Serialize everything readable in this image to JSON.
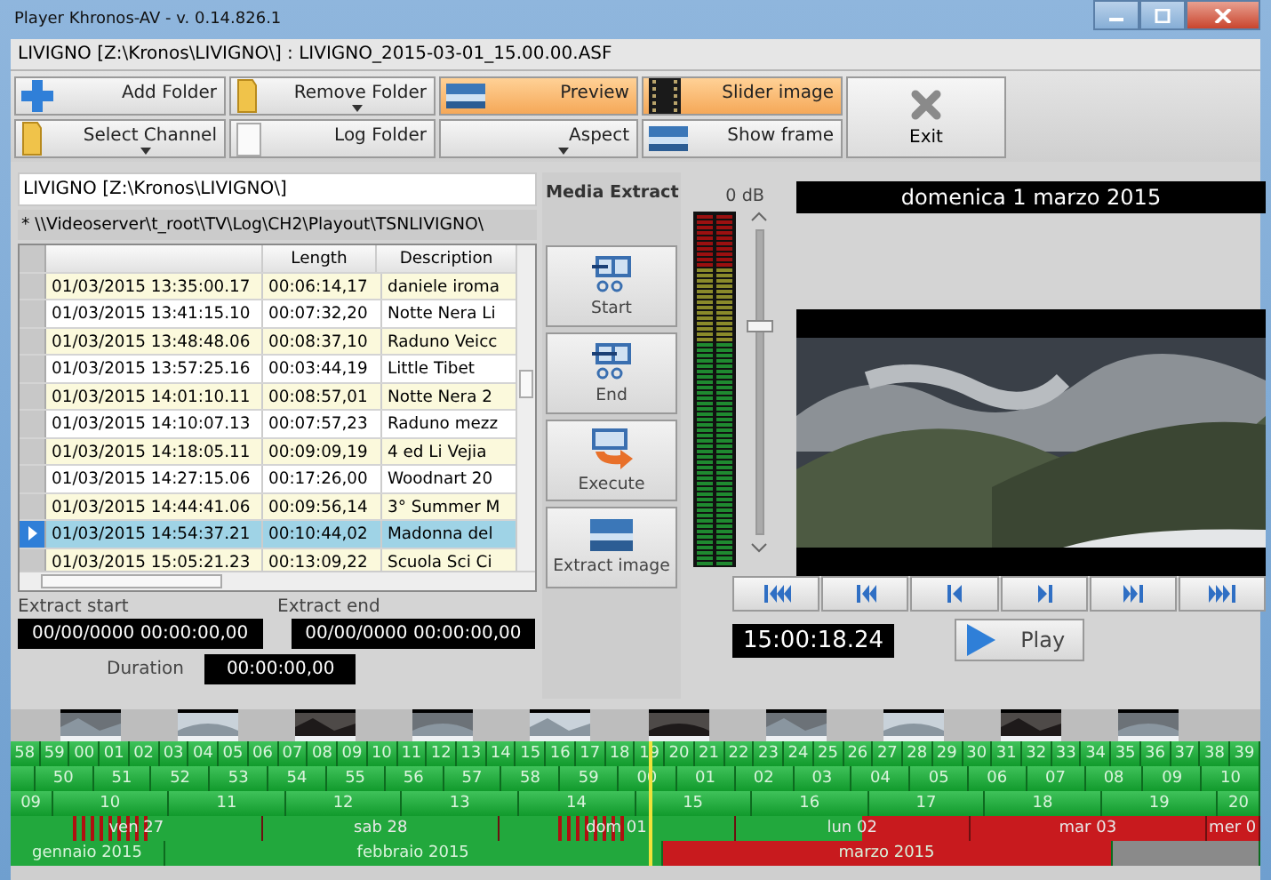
{
  "window": {
    "title": "Player Khronos-AV - v. 0.14.826.1"
  },
  "path_bar": "LIVIGNO [Z:\\Kronos\\LIVIGNO\\] : LIVIGNO_2015-03-01_15.00.00.ASF",
  "toolbar": [
    {
      "label": "Add Folder",
      "kind": "add",
      "on": false,
      "dropdown": false
    },
    {
      "label": "Remove Folder",
      "kind": "folder",
      "on": false,
      "dropdown": true
    },
    {
      "label": "Preview",
      "on": true,
      "dropdown": false
    },
    {
      "label": "Slider image",
      "kind": "film",
      "on": true,
      "dropdown": false
    },
    {
      "label": "Select Channel",
      "kind": "folder",
      "on": false,
      "dropdown": true
    },
    {
      "label": "Log Folder",
      "kind": "page",
      "on": false,
      "dropdown": false
    },
    {
      "label": "Aspect",
      "kind": "plain",
      "on": false,
      "dropdown": true
    },
    {
      "label": "Show frame",
      "on": false,
      "dropdown": false
    }
  ],
  "exit_button": "Exit",
  "channel_field": "LIVIGNO [Z:\\Kronos\\LIVIGNO\\]",
  "log_path": "* \\\\Videoserver\\t_root\\TV\\Log\\CH2\\Playout\\TSNLIVIGNO\\",
  "table": {
    "columns": [
      "Length",
      "Description"
    ],
    "rows": [
      {
        "time": "01/03/2015 13:35:00.17",
        "length": "00:06:14,17",
        "description": "daniele iroma",
        "selected": false
      },
      {
        "time": "01/03/2015 13:41:15.10",
        "length": "00:07:32,20",
        "description": "Notte Nera Li",
        "selected": false
      },
      {
        "time": "01/03/2015 13:48:48.06",
        "length": "00:08:37,10",
        "description": "Raduno Veicc",
        "selected": false
      },
      {
        "time": "01/03/2015 13:57:25.16",
        "length": "00:03:44,19",
        "description": "Little Tibet",
        "selected": false
      },
      {
        "time": "01/03/2015 14:01:10.11",
        "length": "00:08:57,01",
        "description": "Notte Nera 2",
        "selected": false
      },
      {
        "time": "01/03/2015 14:10:07.13",
        "length": "00:07:57,23",
        "description": "Raduno mezz",
        "selected": false
      },
      {
        "time": "01/03/2015 14:18:05.11",
        "length": "00:09:09,19",
        "description": "4 ed Li Vejia",
        "selected": false
      },
      {
        "time": "01/03/2015 14:27:15.06",
        "length": "00:17:26,00",
        "description": "Woodnart 20",
        "selected": false
      },
      {
        "time": "01/03/2015 14:44:41.06",
        "length": "00:09:56,14",
        "description": "3° Summer M",
        "selected": false
      },
      {
        "time": "01/03/2015 14:54:37.21",
        "length": "00:10:44,02",
        "description": "Madonna del",
        "selected": true
      },
      {
        "time": "01/03/2015 15:05:21.23",
        "length": "00:13:09,22",
        "description": "Scuola Sci Ci",
        "selected": false
      }
    ]
  },
  "extract": {
    "start_label": "Extract start",
    "start_value": "00/00/0000 00:00:00,00",
    "end_label": "Extract end",
    "end_value": "00/00/0000 00:00:00,00",
    "duration_label": "Duration",
    "duration_value": "00:00:00,00"
  },
  "media_extract": {
    "title": "Media Extract",
    "buttons": [
      {
        "label": "Start",
        "kind": "cut"
      },
      {
        "label": "End",
        "kind": "cut"
      },
      {
        "label": "Execute",
        "kind": "execute"
      },
      {
        "label": "Extract image"
      }
    ]
  },
  "volume": {
    "label": "0 dB",
    "level": 0.68
  },
  "date_display": "domenica 1 marzo 2015",
  "transport": [
    {
      "kind": "first"
    },
    {
      "kind": "rewind"
    },
    {
      "kind": "back"
    },
    {
      "kind": "forward"
    },
    {
      "kind": "fastforward"
    },
    {
      "kind": "last"
    }
  ],
  "timecode": "15:00:18.24",
  "play_button": "Play",
  "timeline": {
    "playhead": {
      "level": 0.51
    },
    "seconds": [
      "58",
      "59",
      "00",
      "01",
      "02",
      "03",
      "04",
      "05",
      "06",
      "07",
      "08",
      "09",
      "10",
      "11",
      "12",
      "13",
      "14",
      "15",
      "16",
      "17",
      "18",
      "19",
      "20",
      "21",
      "22",
      "23",
      "24",
      "25",
      "26",
      "27",
      "28",
      "29",
      "30",
      "31",
      "32",
      "33",
      "34",
      "35",
      "36",
      "37",
      "38",
      "39"
    ],
    "minutes": [
      "50",
      "51",
      "52",
      "53",
      "54",
      "55",
      "56",
      "57",
      "58",
      "59",
      "00",
      "01",
      "02",
      "03",
      "04",
      "05",
      "06",
      "07",
      "08",
      "09",
      "10"
    ],
    "hours": [
      "09",
      "10",
      "11",
      "12",
      "13",
      "14",
      "15",
      "16",
      "17",
      "18",
      "19",
      "20"
    ],
    "day_coverage": [
      {
        "color": "#22a83d"
      },
      {
        "color": "#c81a1e"
      }
    ],
    "days": [
      {
        "label": "ven 27",
        "gap_marks": true
      },
      {
        "label": "sab 28",
        "gap_marks": false
      },
      {
        "label": "dom 01",
        "gap_marks": true
      },
      {
        "label": "lun 02",
        "gap_marks": false
      },
      {
        "label": "mar 03",
        "gap_marks": false
      },
      {
        "label": "mer 0",
        "gap_marks": false
      }
    ],
    "months": [
      {
        "label": "gennaio 2015",
        "color": "#22a83d"
      },
      {
        "label": "febbraio 2015",
        "color": "#22a83d"
      },
      {
        "label": "marzo 2015",
        "color": "#c81a1e"
      },
      {
        "color": "#8a8a8a"
      }
    ]
  }
}
